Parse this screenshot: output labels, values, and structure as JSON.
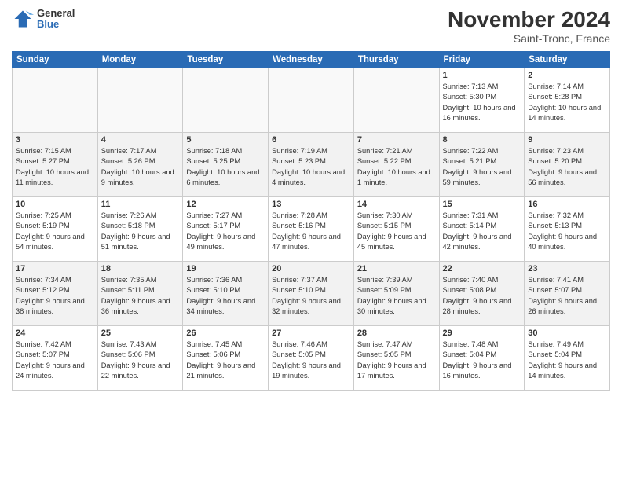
{
  "header": {
    "logo_general": "General",
    "logo_blue": "Blue",
    "title": "November 2024",
    "location": "Saint-Tronc, France"
  },
  "days_of_week": [
    "Sunday",
    "Monday",
    "Tuesday",
    "Wednesday",
    "Thursday",
    "Friday",
    "Saturday"
  ],
  "weeks": [
    [
      {
        "day": "",
        "info": ""
      },
      {
        "day": "",
        "info": ""
      },
      {
        "day": "",
        "info": ""
      },
      {
        "day": "",
        "info": ""
      },
      {
        "day": "",
        "info": ""
      },
      {
        "day": "1",
        "info": "Sunrise: 7:13 AM\nSunset: 5:30 PM\nDaylight: 10 hours and 16 minutes."
      },
      {
        "day": "2",
        "info": "Sunrise: 7:14 AM\nSunset: 5:28 PM\nDaylight: 10 hours and 14 minutes."
      }
    ],
    [
      {
        "day": "3",
        "info": "Sunrise: 7:15 AM\nSunset: 5:27 PM\nDaylight: 10 hours and 11 minutes."
      },
      {
        "day": "4",
        "info": "Sunrise: 7:17 AM\nSunset: 5:26 PM\nDaylight: 10 hours and 9 minutes."
      },
      {
        "day": "5",
        "info": "Sunrise: 7:18 AM\nSunset: 5:25 PM\nDaylight: 10 hours and 6 minutes."
      },
      {
        "day": "6",
        "info": "Sunrise: 7:19 AM\nSunset: 5:23 PM\nDaylight: 10 hours and 4 minutes."
      },
      {
        "day": "7",
        "info": "Sunrise: 7:21 AM\nSunset: 5:22 PM\nDaylight: 10 hours and 1 minute."
      },
      {
        "day": "8",
        "info": "Sunrise: 7:22 AM\nSunset: 5:21 PM\nDaylight: 9 hours and 59 minutes."
      },
      {
        "day": "9",
        "info": "Sunrise: 7:23 AM\nSunset: 5:20 PM\nDaylight: 9 hours and 56 minutes."
      }
    ],
    [
      {
        "day": "10",
        "info": "Sunrise: 7:25 AM\nSunset: 5:19 PM\nDaylight: 9 hours and 54 minutes."
      },
      {
        "day": "11",
        "info": "Sunrise: 7:26 AM\nSunset: 5:18 PM\nDaylight: 9 hours and 51 minutes."
      },
      {
        "day": "12",
        "info": "Sunrise: 7:27 AM\nSunset: 5:17 PM\nDaylight: 9 hours and 49 minutes."
      },
      {
        "day": "13",
        "info": "Sunrise: 7:28 AM\nSunset: 5:16 PM\nDaylight: 9 hours and 47 minutes."
      },
      {
        "day": "14",
        "info": "Sunrise: 7:30 AM\nSunset: 5:15 PM\nDaylight: 9 hours and 45 minutes."
      },
      {
        "day": "15",
        "info": "Sunrise: 7:31 AM\nSunset: 5:14 PM\nDaylight: 9 hours and 42 minutes."
      },
      {
        "day": "16",
        "info": "Sunrise: 7:32 AM\nSunset: 5:13 PM\nDaylight: 9 hours and 40 minutes."
      }
    ],
    [
      {
        "day": "17",
        "info": "Sunrise: 7:34 AM\nSunset: 5:12 PM\nDaylight: 9 hours and 38 minutes."
      },
      {
        "day": "18",
        "info": "Sunrise: 7:35 AM\nSunset: 5:11 PM\nDaylight: 9 hours and 36 minutes."
      },
      {
        "day": "19",
        "info": "Sunrise: 7:36 AM\nSunset: 5:10 PM\nDaylight: 9 hours and 34 minutes."
      },
      {
        "day": "20",
        "info": "Sunrise: 7:37 AM\nSunset: 5:10 PM\nDaylight: 9 hours and 32 minutes."
      },
      {
        "day": "21",
        "info": "Sunrise: 7:39 AM\nSunset: 5:09 PM\nDaylight: 9 hours and 30 minutes."
      },
      {
        "day": "22",
        "info": "Sunrise: 7:40 AM\nSunset: 5:08 PM\nDaylight: 9 hours and 28 minutes."
      },
      {
        "day": "23",
        "info": "Sunrise: 7:41 AM\nSunset: 5:07 PM\nDaylight: 9 hours and 26 minutes."
      }
    ],
    [
      {
        "day": "24",
        "info": "Sunrise: 7:42 AM\nSunset: 5:07 PM\nDaylight: 9 hours and 24 minutes."
      },
      {
        "day": "25",
        "info": "Sunrise: 7:43 AM\nSunset: 5:06 PM\nDaylight: 9 hours and 22 minutes."
      },
      {
        "day": "26",
        "info": "Sunrise: 7:45 AM\nSunset: 5:06 PM\nDaylight: 9 hours and 21 minutes."
      },
      {
        "day": "27",
        "info": "Sunrise: 7:46 AM\nSunset: 5:05 PM\nDaylight: 9 hours and 19 minutes."
      },
      {
        "day": "28",
        "info": "Sunrise: 7:47 AM\nSunset: 5:05 PM\nDaylight: 9 hours and 17 minutes."
      },
      {
        "day": "29",
        "info": "Sunrise: 7:48 AM\nSunset: 5:04 PM\nDaylight: 9 hours and 16 minutes."
      },
      {
        "day": "30",
        "info": "Sunrise: 7:49 AM\nSunset: 5:04 PM\nDaylight: 9 hours and 14 minutes."
      }
    ]
  ]
}
